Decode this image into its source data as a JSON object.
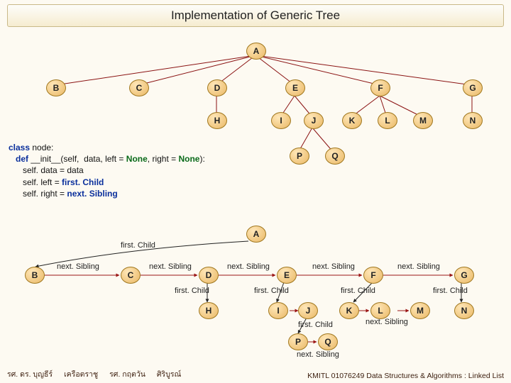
{
  "title": "Implementation of Generic Tree",
  "code": {
    "l1a": "class",
    "l1b": " node:",
    "l2a": "   def ",
    "l2b": "__init__",
    "l2c": "(self,  data, left = ",
    "l2d": "None",
    "l2e": ", right = ",
    "l2f": "None",
    "l2g": "):",
    "l3": "      self. data = data",
    "l4a": "      self. left = ",
    "l4b": "first. Child",
    "l5a": "      self. right = ",
    "l5b": "next. Sibling"
  },
  "labels": {
    "firstChild": "first. Child",
    "nextSibling": "next. Sibling"
  },
  "top_tree": {
    "A": "A",
    "B": "B",
    "C": "C",
    "D": "D",
    "E": "E",
    "F": "F",
    "G": "G",
    "H": "H",
    "I": "I",
    "J": "J",
    "K": "K",
    "L": "L",
    "M": "M",
    "N": "N",
    "P": "P",
    "Q": "Q"
  },
  "bottom_tree": {
    "A": "A",
    "B": "B",
    "C": "C",
    "D": "D",
    "E": "E",
    "F": "F",
    "G": "G",
    "H": "H",
    "I": "I",
    "J": "J",
    "K": "K",
    "L": "L",
    "M": "M",
    "N": "N",
    "P": "P",
    "Q": "Q"
  },
  "footer": {
    "authors": [
      "รศ. ดร. บุญธีร์",
      "เครือตราชู",
      "รศ. กฤตวัน",
      "ศิริบูรณ์"
    ],
    "right": "KMITL   01076249 Data Structures & Algorithms : Linked List"
  },
  "chart_data": [
    {
      "type": "tree",
      "title": "Generic tree (conceptual)",
      "nodes": [
        "A",
        "B",
        "C",
        "D",
        "E",
        "F",
        "G",
        "H",
        "I",
        "J",
        "K",
        "L",
        "M",
        "N",
        "P",
        "Q"
      ],
      "children": {
        "A": [
          "B",
          "C",
          "D",
          "E",
          "F",
          "G"
        ],
        "D": [
          "H"
        ],
        "E": [
          "I",
          "J"
        ],
        "F": [
          "K",
          "L",
          "M"
        ],
        "G": [
          "N"
        ],
        "J": [
          "P",
          "Q"
        ]
      }
    },
    {
      "type": "tree",
      "title": "Left-child / right-sibling representation",
      "nodes": [
        "A",
        "B",
        "C",
        "D",
        "E",
        "F",
        "G",
        "H",
        "I",
        "J",
        "K",
        "L",
        "M",
        "N",
        "P",
        "Q"
      ],
      "firstChild": {
        "A": "B",
        "D": "H",
        "E": "I",
        "F": "K",
        "G": "N",
        "J": "P"
      },
      "nextSibling": {
        "B": "C",
        "C": "D",
        "D": "E",
        "E": "F",
        "F": "G",
        "I": "J",
        "K": "L",
        "L": "M",
        "P": "Q"
      }
    }
  ]
}
